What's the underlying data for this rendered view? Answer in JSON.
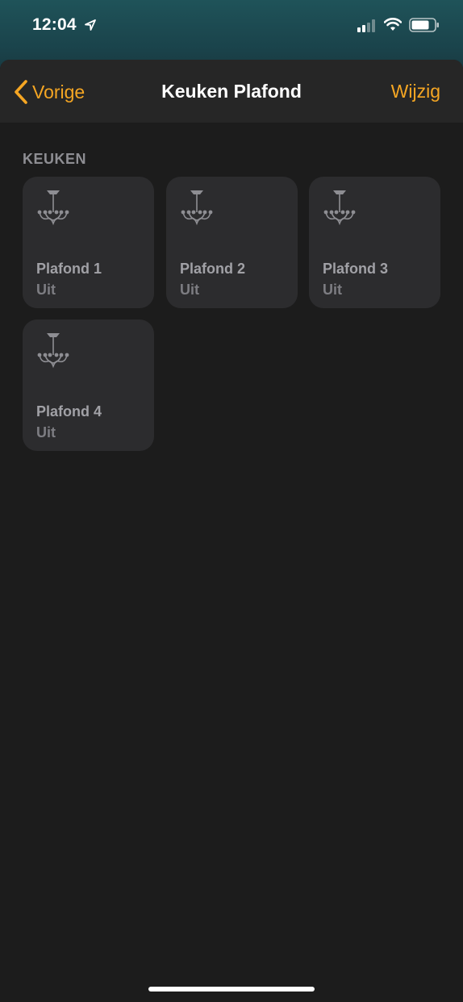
{
  "status_bar": {
    "time": "12:04",
    "icons": [
      "location-arrow-icon",
      "cellular-signal-icon",
      "wifi-icon",
      "battery-icon"
    ]
  },
  "nav": {
    "back_label": "Vorige",
    "title": "Keuken Plafond",
    "edit_label": "Wijzig"
  },
  "section": {
    "header": "KEUKEN"
  },
  "accessories": [
    {
      "name": "Plafond 1",
      "state": "Uit",
      "icon": "chandelier-icon"
    },
    {
      "name": "Plafond 2",
      "state": "Uit",
      "icon": "chandelier-icon"
    },
    {
      "name": "Plafond 3",
      "state": "Uit",
      "icon": "chandelier-icon"
    },
    {
      "name": "Plafond 4",
      "state": "Uit",
      "icon": "chandelier-icon"
    }
  ],
  "colors": {
    "accent": "#f5a623",
    "background": "#1c1c1c",
    "tile": "#2c2c2e",
    "nav_bar": "#262626"
  }
}
